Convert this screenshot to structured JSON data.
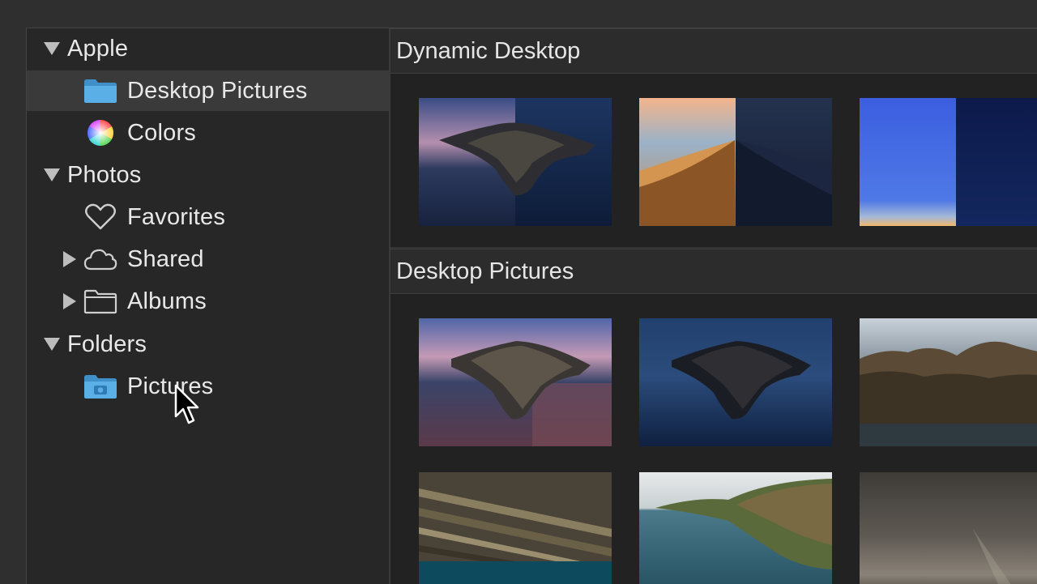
{
  "sidebar": {
    "groups": [
      {
        "label": "Apple",
        "expanded": true
      },
      {
        "label": "Photos",
        "expanded": true
      },
      {
        "label": "Folders",
        "expanded": true
      }
    ],
    "items": [
      {
        "label": "Desktop Pictures",
        "icon": "folder-icon",
        "selected": true
      },
      {
        "label": "Colors",
        "icon": "color-wheel-icon"
      },
      {
        "label": "Favorites",
        "icon": "heart-icon"
      },
      {
        "label": "Shared",
        "icon": "cloud-icon",
        "collapsed": true
      },
      {
        "label": "Albums",
        "icon": "folder-outline-icon",
        "collapsed": true
      },
      {
        "label": "Pictures",
        "icon": "camera-folder-icon"
      }
    ]
  },
  "main": {
    "sections": [
      {
        "title": "Dynamic Desktop",
        "thumbnails": [
          "Catalina island day/night",
          "Mojave dunes day/night",
          "Solar gradient day/night"
        ]
      },
      {
        "title": "Desktop Pictures",
        "thumbnails": [
          "Catalina evening",
          "Catalina night",
          "Coastal mountains",
          "Rock strata",
          "Coastline cliffs",
          "Cloudy sea"
        ]
      }
    ]
  },
  "colors": {
    "accent_folder": "#4aa3df",
    "sidebar_bg": "#272727",
    "selected_row": "#3a3a3a",
    "content_bg": "#222222"
  }
}
